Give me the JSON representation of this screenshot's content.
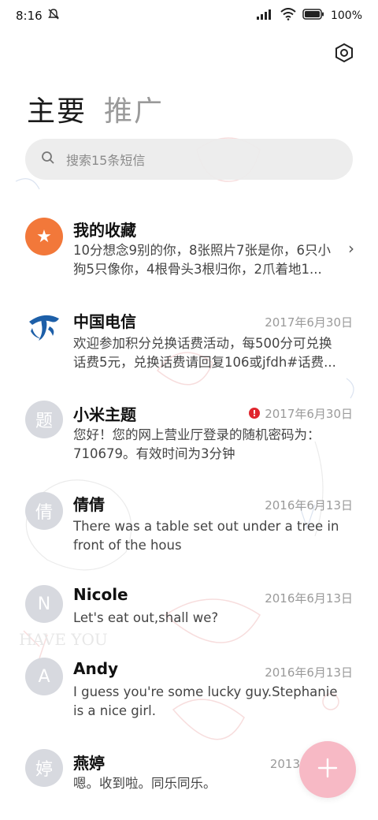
{
  "status_bar": {
    "time": "8:16",
    "battery": "100%"
  },
  "tabs": [
    {
      "label": "主要"
    },
    {
      "label": "推广"
    }
  ],
  "search": {
    "placeholder": "搜索15条短信"
  },
  "conversations": [
    {
      "avatar_text": "★",
      "avatar_color": "#f2783a",
      "name": "我的收藏",
      "date": "",
      "line1": "10分想念9别的你，8张照片7张是你，6只小",
      "line2": "狗5只像你，4根骨头3根归你，2爪着地1..."
    },
    {
      "avatar_text": "",
      "avatar_color": "#1d5fa8",
      "name": "中国电信",
      "date": "2017年6月30日",
      "line1": "欢迎参加积分兑换话费活动，每500分可兑换",
      "line2": "话费5元，兑换话费请回复106或jfdh#话费..."
    },
    {
      "avatar_text": "题",
      "avatar_color": "#d7d9df",
      "name": "小米主题",
      "date": "2017年6月30日",
      "line1": "您好！您的网上营业厅登录的随机密码为：",
      "line2": "710679。有效时间为3分钟"
    },
    {
      "avatar_text": "倩",
      "avatar_color": "#d7d9df",
      "name": "倩倩",
      "date": "2016年6月13日",
      "line1": "There was a table set out under a tree in",
      "line2": "front of the hous"
    },
    {
      "avatar_text": "N",
      "avatar_color": "#d7d9df",
      "name": "Nicole",
      "date": "2016年6月13日",
      "line1": "Let's eat out,shall we?",
      "line2": ""
    },
    {
      "avatar_text": "A",
      "avatar_color": "#d7d9df",
      "name": "Andy",
      "date": "2016年6月13日",
      "line1": "I guess you're some lucky guy.Stephanie",
      "line2": "is a nice girl."
    },
    {
      "avatar_text": "婷",
      "avatar_color": "#d7d9df",
      "name": "燕婷",
      "date": "2013年",
      "line1": "嗯。收到啦。同乐同乐。",
      "line2": ""
    }
  ],
  "fab": {
    "icon": "plus-icon",
    "color": "#f7b9c5"
  }
}
